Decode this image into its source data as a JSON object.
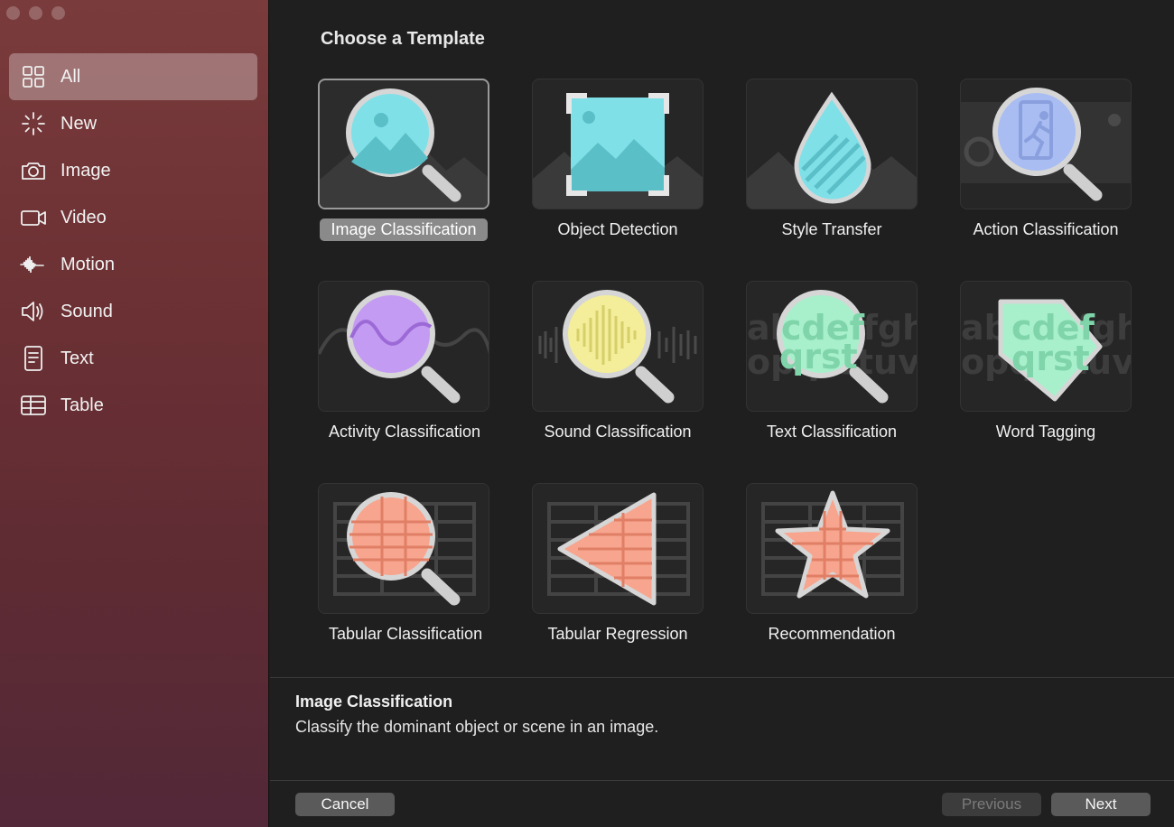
{
  "sidebar": {
    "items": [
      {
        "label": "All",
        "icon": "grid-icon",
        "selected": true
      },
      {
        "label": "New",
        "icon": "sparkle-icon",
        "selected": false
      },
      {
        "label": "Image",
        "icon": "camera-icon",
        "selected": false
      },
      {
        "label": "Video",
        "icon": "video-camera-icon",
        "selected": false
      },
      {
        "label": "Motion",
        "icon": "waveform-icon",
        "selected": false
      },
      {
        "label": "Sound",
        "icon": "speaker-icon",
        "selected": false
      },
      {
        "label": "Text",
        "icon": "document-icon",
        "selected": false
      },
      {
        "label": "Table",
        "icon": "table-icon",
        "selected": false
      }
    ]
  },
  "main": {
    "title": "Choose a Template",
    "templates": [
      {
        "label": "Image Classification",
        "icon": "magnifier-image-icon",
        "selected": true
      },
      {
        "label": "Object Detection",
        "icon": "bounding-box-image-icon",
        "selected": false
      },
      {
        "label": "Style Transfer",
        "icon": "droplet-icon",
        "selected": false
      },
      {
        "label": "Action Classification",
        "icon": "magnifier-running-person-icon",
        "selected": false
      },
      {
        "label": "Activity Classification",
        "icon": "magnifier-sine-wave-icon",
        "selected": false
      },
      {
        "label": "Sound Classification",
        "icon": "magnifier-audio-wave-icon",
        "selected": false
      },
      {
        "label": "Text Classification",
        "icon": "magnifier-text-icon",
        "selected": false
      },
      {
        "label": "Word Tagging",
        "icon": "tag-text-icon",
        "selected": false
      },
      {
        "label": "Tabular Classification",
        "icon": "magnifier-table-icon",
        "selected": false
      },
      {
        "label": "Tabular Regression",
        "icon": "triangle-table-icon",
        "selected": false
      },
      {
        "label": "Recommendation",
        "icon": "star-table-icon",
        "selected": false
      }
    ]
  },
  "description": {
    "title": "Image Classification",
    "text": "Classify the dominant object or scene in an image."
  },
  "buttons": {
    "cancel": "Cancel",
    "previous": "Previous",
    "next": "Next"
  },
  "colors": {
    "accent_cyan": "#7fe0e8",
    "accent_purple": "#c49bf2",
    "accent_yellow": "#f4ee9a",
    "accent_mint": "#a8f0cc",
    "accent_salmon": "#f7a58e"
  }
}
